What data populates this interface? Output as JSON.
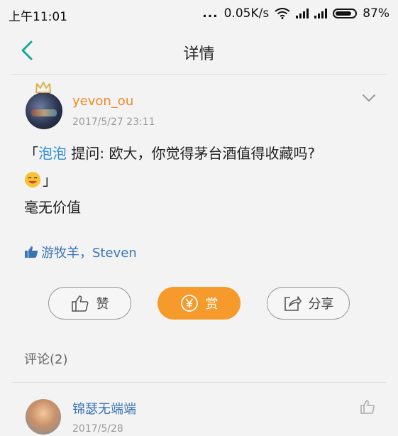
{
  "status_bar": {
    "time": "上午11:01",
    "dots": "...",
    "speed": "0.05K/s",
    "battery": "87%"
  },
  "nav": {
    "title": "详情"
  },
  "post": {
    "author": "yevon_ou",
    "time": "2017/5/27 23:11",
    "quote_open": "「",
    "tag": "泡泡",
    "question": " 提问: 欧大，你觉得茅台酒值得收藏吗?",
    "quote_close": "」",
    "answer": "毫无价值",
    "likers": "游牧羊，Steven"
  },
  "actions": {
    "like_label": "赞",
    "reward_label": "赏",
    "share_label": "分享"
  },
  "comments": {
    "title": "评论(2)",
    "items": [
      {
        "author": "锦瑟无端端",
        "time": "2017/5/28"
      }
    ]
  },
  "colors": {
    "author": "#f08a24",
    "link": "#3b73b6",
    "reward": "#f69a2b",
    "accent": "#1aa79a"
  }
}
